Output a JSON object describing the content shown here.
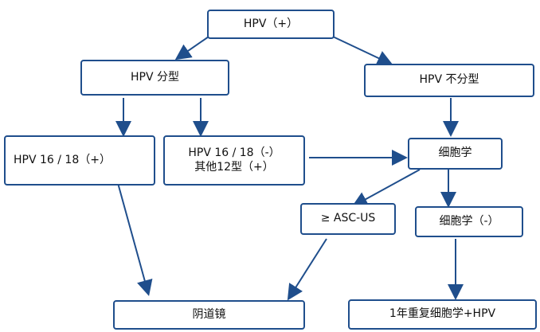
{
  "nodes": {
    "hpv_positive": "HPV（+）",
    "hpv_typed": "HPV 分型",
    "hpv_untyped": "HPV 不分型",
    "hpv_16_18_positive": "HPV 16 / 18（+）",
    "hpv_16_18_negative_line1": "HPV 16 / 18（-）",
    "hpv_16_18_negative_line2": "其他12型（+）",
    "cytology": "细胞学",
    "asc_us": "≥ ASC-US",
    "cytology_negative": "细胞学（-）",
    "colposcopy": "阴道镜",
    "repeat_after_year": "1年重复细胞学+HPV"
  },
  "colors": {
    "border": "#1f4e8c",
    "arrow": "#1f4e8c",
    "text": "#111111"
  }
}
